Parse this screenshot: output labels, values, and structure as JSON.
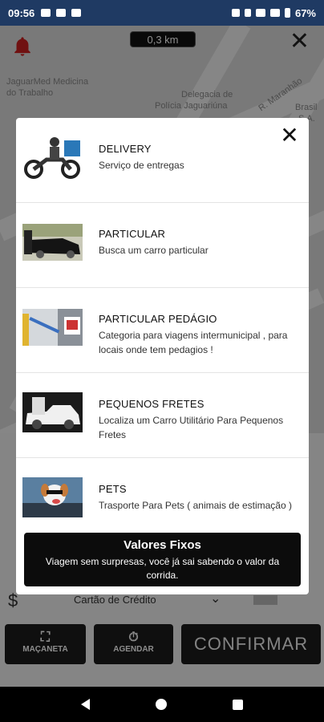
{
  "status_bar": {
    "time": "09:56",
    "battery": "67%"
  },
  "map": {
    "distance": "0,3 km",
    "labels": {
      "jaguarmed": "JaguarMed Medicina",
      "do_trabalho": "do Trabalho",
      "delegacia": "Delegacia de",
      "policia": "Polícia Jaguariúna",
      "maranhao": "R. Maranhão",
      "brasil": "Brasil",
      "sa": "S.A."
    }
  },
  "modal": {
    "services": [
      {
        "name": "DELIVERY",
        "desc": "Serviço de entregas",
        "icon": "motorcycle-delivery"
      },
      {
        "name": "PARTICULAR",
        "desc": "Busca um carro particular",
        "icon": "private-car"
      },
      {
        "name": "PARTICULAR PEDÁGIO",
        "desc": "Categoria para viagens intermunicipal , para locais onde tem pedagios !",
        "icon": "toll-booth"
      },
      {
        "name": "PEQUENOS FRETES",
        "desc": "Localiza um Carro Utilitário Para Pequenos Fretes",
        "icon": "pickup-truck"
      },
      {
        "name": "PETS",
        "desc": "Trasporte Para Pets ( animais de estimação )",
        "icon": "dog-in-car"
      }
    ],
    "fixed_values": {
      "title": "Valores Fixos",
      "desc": "Viagem sem surpresas, você já sai sabendo o valor da corrida."
    }
  },
  "bottom": {
    "payment_method": "Cartão de Crédito",
    "buttons": {
      "handle": "MAÇANETA",
      "schedule": "AGENDAR",
      "confirm": "CONFIRMAR"
    }
  },
  "colors": {
    "status_bar": "#1f3a63",
    "bell": "#cc1f1f",
    "dark_button": "#1c1c1c"
  }
}
